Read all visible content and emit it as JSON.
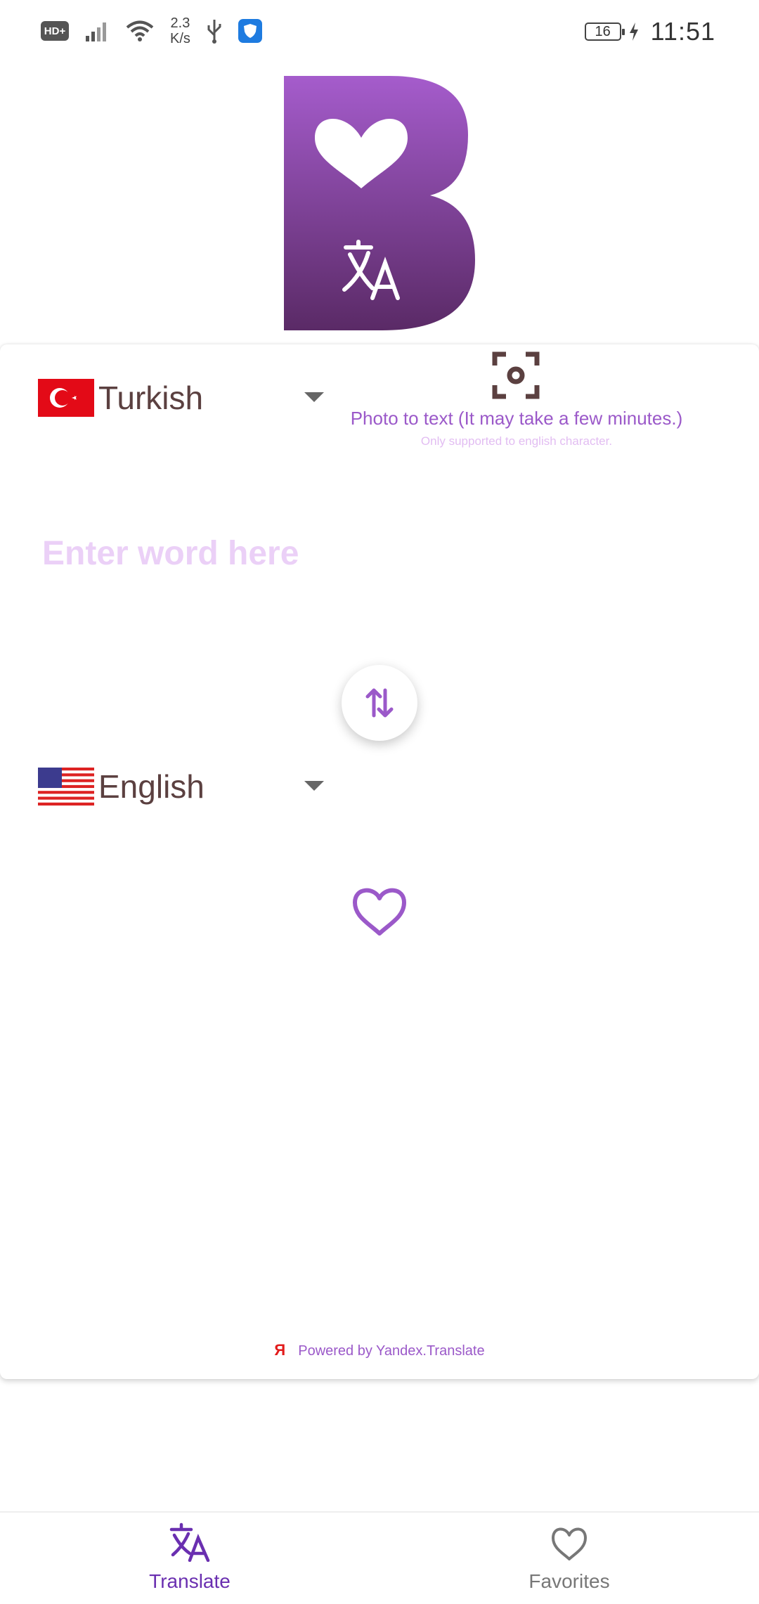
{
  "status_bar": {
    "hd_label": "HD+",
    "speed_value": "2.3",
    "speed_unit": "K/s",
    "battery_level": "16",
    "time": "11:51"
  },
  "source": {
    "language": "Turkish",
    "flag_icon": "turkey-flag-icon",
    "input_placeholder": "Enter word here",
    "input_value": ""
  },
  "photo": {
    "label": "Photo to text (It may take a few minutes.)",
    "note": "Only supported to english character."
  },
  "target": {
    "language": "English",
    "flag_icon": "us-flag-icon"
  },
  "footer": {
    "yandex_mark": "Я",
    "powered_by": "Powered by Yandex.Translate"
  },
  "nav": {
    "translate_label": "Translate",
    "favorites_label": "Favorites",
    "active": "Translate"
  },
  "colors": {
    "accent": "#9b59c9",
    "accent_dark": "#6a2fb0",
    "logo_gradient_top": "#a55ccc",
    "logo_gradient_bottom": "#5a2a66",
    "placeholder": "#ebd0f7",
    "text": "#5b4040",
    "inactive_nav": "#777777"
  }
}
